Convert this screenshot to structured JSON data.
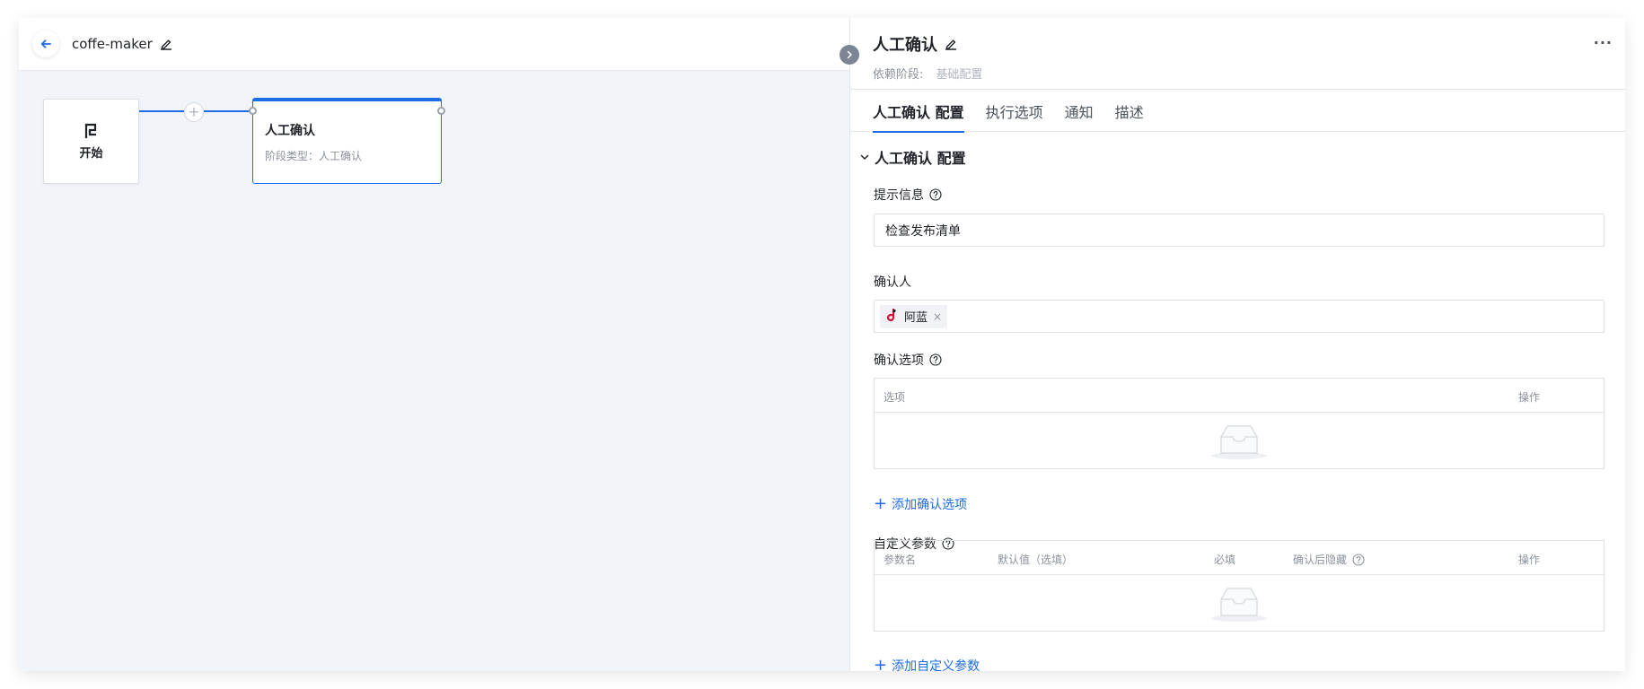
{
  "canvas": {
    "pipeline_name": "coffe-maker",
    "start_node": {
      "label": "开始",
      "icon": "flag-icon"
    },
    "stage_node": {
      "title": "人工确认",
      "subtitle": "阶段类型：人工确认"
    },
    "add_node_icon": "+"
  },
  "panel": {
    "title": "人工确认",
    "dependency_label": "依赖阶段:",
    "dependency_value": "基础配置",
    "more_icon": "···",
    "tabs": [
      {
        "label": "人工确认 配置",
        "active": true
      },
      {
        "label": "执行选项",
        "active": false
      },
      {
        "label": "通知",
        "active": false
      },
      {
        "label": "描述",
        "active": false
      }
    ],
    "section_title": "人工确认 配置",
    "prompt": {
      "label": "提示信息",
      "value": "检查发布清单"
    },
    "confirmer": {
      "label": "确认人",
      "tag": "阿蓝",
      "tag_close": "×"
    },
    "options": {
      "label": "确认选项",
      "columns": [
        "选项",
        "操作"
      ],
      "add_label": "添加确认选项"
    },
    "params": {
      "label": "自定义参数",
      "columns": [
        "参数名",
        "默认值（选填）",
        "必填",
        "确认后隐藏",
        "操作"
      ],
      "add_label": "添加自定义参数"
    }
  },
  "colors": {
    "accent": "#1e6be6",
    "canvas_bg": "#f1f4f9",
    "border": "#dde1e6",
    "muted_text": "#8b929c"
  }
}
